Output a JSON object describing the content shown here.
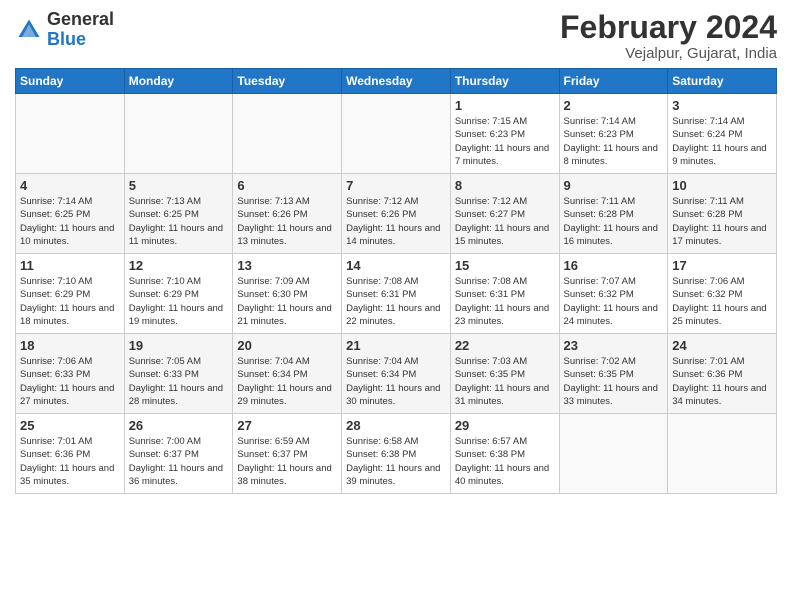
{
  "app": {
    "logo_line1": "General",
    "logo_line2": "Blue"
  },
  "header": {
    "month": "February 2024",
    "location": "Vejalpur, Gujarat, India"
  },
  "weekdays": [
    "Sunday",
    "Monday",
    "Tuesday",
    "Wednesday",
    "Thursday",
    "Friday",
    "Saturday"
  ],
  "weeks": [
    [
      {
        "day": "",
        "sunrise": "",
        "sunset": "",
        "daylight": ""
      },
      {
        "day": "",
        "sunrise": "",
        "sunset": "",
        "daylight": ""
      },
      {
        "day": "",
        "sunrise": "",
        "sunset": "",
        "daylight": ""
      },
      {
        "day": "",
        "sunrise": "",
        "sunset": "",
        "daylight": ""
      },
      {
        "day": "1",
        "sunrise": "Sunrise: 7:15 AM",
        "sunset": "Sunset: 6:23 PM",
        "daylight": "Daylight: 11 hours and 7 minutes."
      },
      {
        "day": "2",
        "sunrise": "Sunrise: 7:14 AM",
        "sunset": "Sunset: 6:23 PM",
        "daylight": "Daylight: 11 hours and 8 minutes."
      },
      {
        "day": "3",
        "sunrise": "Sunrise: 7:14 AM",
        "sunset": "Sunset: 6:24 PM",
        "daylight": "Daylight: 11 hours and 9 minutes."
      }
    ],
    [
      {
        "day": "4",
        "sunrise": "Sunrise: 7:14 AM",
        "sunset": "Sunset: 6:25 PM",
        "daylight": "Daylight: 11 hours and 10 minutes."
      },
      {
        "day": "5",
        "sunrise": "Sunrise: 7:13 AM",
        "sunset": "Sunset: 6:25 PM",
        "daylight": "Daylight: 11 hours and 11 minutes."
      },
      {
        "day": "6",
        "sunrise": "Sunrise: 7:13 AM",
        "sunset": "Sunset: 6:26 PM",
        "daylight": "Daylight: 11 hours and 13 minutes."
      },
      {
        "day": "7",
        "sunrise": "Sunrise: 7:12 AM",
        "sunset": "Sunset: 6:26 PM",
        "daylight": "Daylight: 11 hours and 14 minutes."
      },
      {
        "day": "8",
        "sunrise": "Sunrise: 7:12 AM",
        "sunset": "Sunset: 6:27 PM",
        "daylight": "Daylight: 11 hours and 15 minutes."
      },
      {
        "day": "9",
        "sunrise": "Sunrise: 7:11 AM",
        "sunset": "Sunset: 6:28 PM",
        "daylight": "Daylight: 11 hours and 16 minutes."
      },
      {
        "day": "10",
        "sunrise": "Sunrise: 7:11 AM",
        "sunset": "Sunset: 6:28 PM",
        "daylight": "Daylight: 11 hours and 17 minutes."
      }
    ],
    [
      {
        "day": "11",
        "sunrise": "Sunrise: 7:10 AM",
        "sunset": "Sunset: 6:29 PM",
        "daylight": "Daylight: 11 hours and 18 minutes."
      },
      {
        "day": "12",
        "sunrise": "Sunrise: 7:10 AM",
        "sunset": "Sunset: 6:29 PM",
        "daylight": "Daylight: 11 hours and 19 minutes."
      },
      {
        "day": "13",
        "sunrise": "Sunrise: 7:09 AM",
        "sunset": "Sunset: 6:30 PM",
        "daylight": "Daylight: 11 hours and 21 minutes."
      },
      {
        "day": "14",
        "sunrise": "Sunrise: 7:08 AM",
        "sunset": "Sunset: 6:31 PM",
        "daylight": "Daylight: 11 hours and 22 minutes."
      },
      {
        "day": "15",
        "sunrise": "Sunrise: 7:08 AM",
        "sunset": "Sunset: 6:31 PM",
        "daylight": "Daylight: 11 hours and 23 minutes."
      },
      {
        "day": "16",
        "sunrise": "Sunrise: 7:07 AM",
        "sunset": "Sunset: 6:32 PM",
        "daylight": "Daylight: 11 hours and 24 minutes."
      },
      {
        "day": "17",
        "sunrise": "Sunrise: 7:06 AM",
        "sunset": "Sunset: 6:32 PM",
        "daylight": "Daylight: 11 hours and 25 minutes."
      }
    ],
    [
      {
        "day": "18",
        "sunrise": "Sunrise: 7:06 AM",
        "sunset": "Sunset: 6:33 PM",
        "daylight": "Daylight: 11 hours and 27 minutes."
      },
      {
        "day": "19",
        "sunrise": "Sunrise: 7:05 AM",
        "sunset": "Sunset: 6:33 PM",
        "daylight": "Daylight: 11 hours and 28 minutes."
      },
      {
        "day": "20",
        "sunrise": "Sunrise: 7:04 AM",
        "sunset": "Sunset: 6:34 PM",
        "daylight": "Daylight: 11 hours and 29 minutes."
      },
      {
        "day": "21",
        "sunrise": "Sunrise: 7:04 AM",
        "sunset": "Sunset: 6:34 PM",
        "daylight": "Daylight: 11 hours and 30 minutes."
      },
      {
        "day": "22",
        "sunrise": "Sunrise: 7:03 AM",
        "sunset": "Sunset: 6:35 PM",
        "daylight": "Daylight: 11 hours and 31 minutes."
      },
      {
        "day": "23",
        "sunrise": "Sunrise: 7:02 AM",
        "sunset": "Sunset: 6:35 PM",
        "daylight": "Daylight: 11 hours and 33 minutes."
      },
      {
        "day": "24",
        "sunrise": "Sunrise: 7:01 AM",
        "sunset": "Sunset: 6:36 PM",
        "daylight": "Daylight: 11 hours and 34 minutes."
      }
    ],
    [
      {
        "day": "25",
        "sunrise": "Sunrise: 7:01 AM",
        "sunset": "Sunset: 6:36 PM",
        "daylight": "Daylight: 11 hours and 35 minutes."
      },
      {
        "day": "26",
        "sunrise": "Sunrise: 7:00 AM",
        "sunset": "Sunset: 6:37 PM",
        "daylight": "Daylight: 11 hours and 36 minutes."
      },
      {
        "day": "27",
        "sunrise": "Sunrise: 6:59 AM",
        "sunset": "Sunset: 6:37 PM",
        "daylight": "Daylight: 11 hours and 38 minutes."
      },
      {
        "day": "28",
        "sunrise": "Sunrise: 6:58 AM",
        "sunset": "Sunset: 6:38 PM",
        "daylight": "Daylight: 11 hours and 39 minutes."
      },
      {
        "day": "29",
        "sunrise": "Sunrise: 6:57 AM",
        "sunset": "Sunset: 6:38 PM",
        "daylight": "Daylight: 11 hours and 40 minutes."
      },
      {
        "day": "",
        "sunrise": "",
        "sunset": "",
        "daylight": ""
      },
      {
        "day": "",
        "sunrise": "",
        "sunset": "",
        "daylight": ""
      }
    ]
  ]
}
